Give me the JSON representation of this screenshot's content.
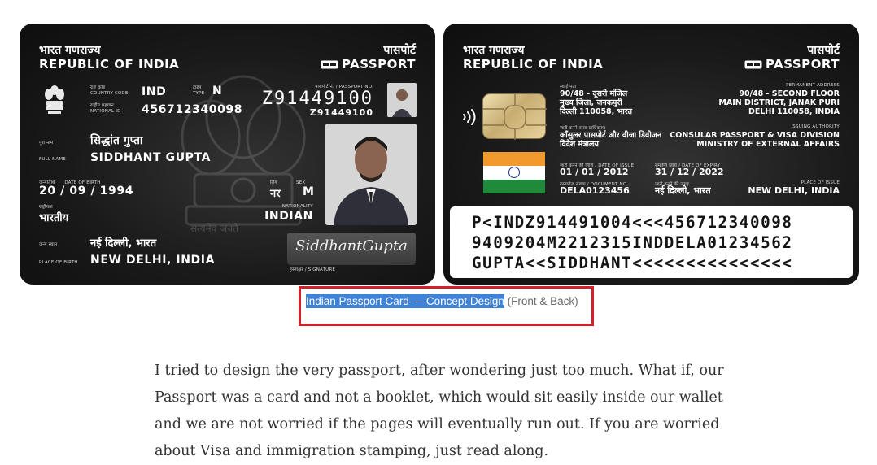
{
  "front": {
    "country_hi": "भारत गणराज्य",
    "country_en": "REPUBLIC OF INDIA",
    "passport_hi": "पासपोर्ट",
    "passport_en": "PASSPORT",
    "country_code_label_hi": "राष्ट्र कोड",
    "country_code_label_en": "COUNTRY CODE",
    "country_code": "IND",
    "type_label_hi": "टाइप",
    "type_label_en": "TYPE",
    "type": "N",
    "national_id_label_hi": "राष्ट्रीय पहचान",
    "national_id_label_en": "NATIONAL ID",
    "national_id": "456712340098",
    "passport_no_label": "पासपोर्ट नं. / PASSPORT NO.",
    "passport_no_big": "Z91449100",
    "passport_no": "Z91449100",
    "name_label_hi": "पूरा नाम",
    "name_label_en": "FULL NAME",
    "name_hi": "सिद्धांत गुप्ता",
    "name_en": "SIDDHANT GUPTA",
    "dob_label_hi": "जन्मतिथि",
    "dob_label_en": "DATE OF BIRTH",
    "dob": "20 / 09 / 1994",
    "sex_label_hi": "लिंग",
    "sex_label_en": "SEX",
    "sex_hi": "नर",
    "sex": "M",
    "nationality_label_hi": "राष्ट्रीयता",
    "nationality_label_en": "NATIONALITY",
    "nationality_hi": "भारतीय",
    "nationality": "INDIAN",
    "motto": "सत्यमेव जयते",
    "pob_label_hi": "जन्म स्थान",
    "pob_label_en": "PLACE OF BIRTH",
    "pob_hi": "नई दिल्ली, भारत",
    "pob": "NEW DELHI, INDIA",
    "signature": "SiddhantGupta",
    "signature_label": "हस्ताक्षर / SIGNATURE"
  },
  "back": {
    "country_hi": "भारत गणराज्य",
    "country_en": "REPUBLIC OF INDIA",
    "passport_hi": "पासपोर्ट",
    "passport_en": "PASSPORT",
    "address_label_hi": "स्थाई पता",
    "address_hi": [
      "90/48 - दूसरी मंजिल",
      "मुख्य जिला, जनकपुरी",
      "दिल्ली 110058, भारत"
    ],
    "address_label_en": "PERMANENT ADDRESS",
    "address_en": [
      "90/48 - SECOND FLOOR",
      "MAIN DISTRICT, JANAK PURI",
      "DELHI 110058, INDIA"
    ],
    "authority_label_hi": "जारी करने वाला प्राधिकरण",
    "authority_hi": [
      "कॉंसुलर पासपोर्ट और वीजा डिवीजन",
      "विदेश मंत्रालय"
    ],
    "authority_label_en": "ISSUING AUTHORITY",
    "authority_en": [
      "CONSULAR PASSPORT & VISA DIVISION",
      "MINISTRY OF EXTERNAL AFFAIRS"
    ],
    "issue_label": "जारी करने की तिथि / DATE OF ISSUE",
    "issue": "01 / 01 / 2012",
    "expiry_label": "समाप्ति तिथि / DATE OF EXPIRY",
    "expiry": "31 / 12 / 2022",
    "doc_label": "दस्तावेज़ संख्या / DOCUMENT NO.",
    "doc": "DELA0123456",
    "poi_label_hi": "जारी करने की जगह",
    "poi_hi": "नई दिल्ली, भारत",
    "poi_label_en": "PLACE OF ISSUE",
    "poi": "NEW DELHI, INDIA",
    "mrz": [
      "P<INDZ914491004<<<456712340098",
      "9409204M2212315INDDELA01234562",
      "GUPTA<<SIDDHANT<<<<<<<<<<<<<<<"
    ]
  },
  "caption": {
    "selected": "Indian Passport Card — Concept Design",
    "rest": " (Front & Back)"
  },
  "article": {
    "lines": [
      "I tried to design the very passport, after wondering just too much. What if, our",
      "Passport was a card and not a booklet, which would sit easily inside our wallet",
      "and we are not worried if the pages will eventually run out. If you are worried",
      "about Visa and immigration stamping, just read along."
    ]
  },
  "colors": {
    "card_bg": "#1a1a1a",
    "chip": "#c7ad72",
    "selection": "#3f83d8",
    "highlight_box": "#d2212b",
    "flag_saffron": "#f39a2f",
    "flag_green": "#1f8b3a"
  },
  "icons": {
    "emblem": "ashoka-emblem-icon",
    "passport": "passport-symbol-icon",
    "contactless": "contactless-icon"
  }
}
